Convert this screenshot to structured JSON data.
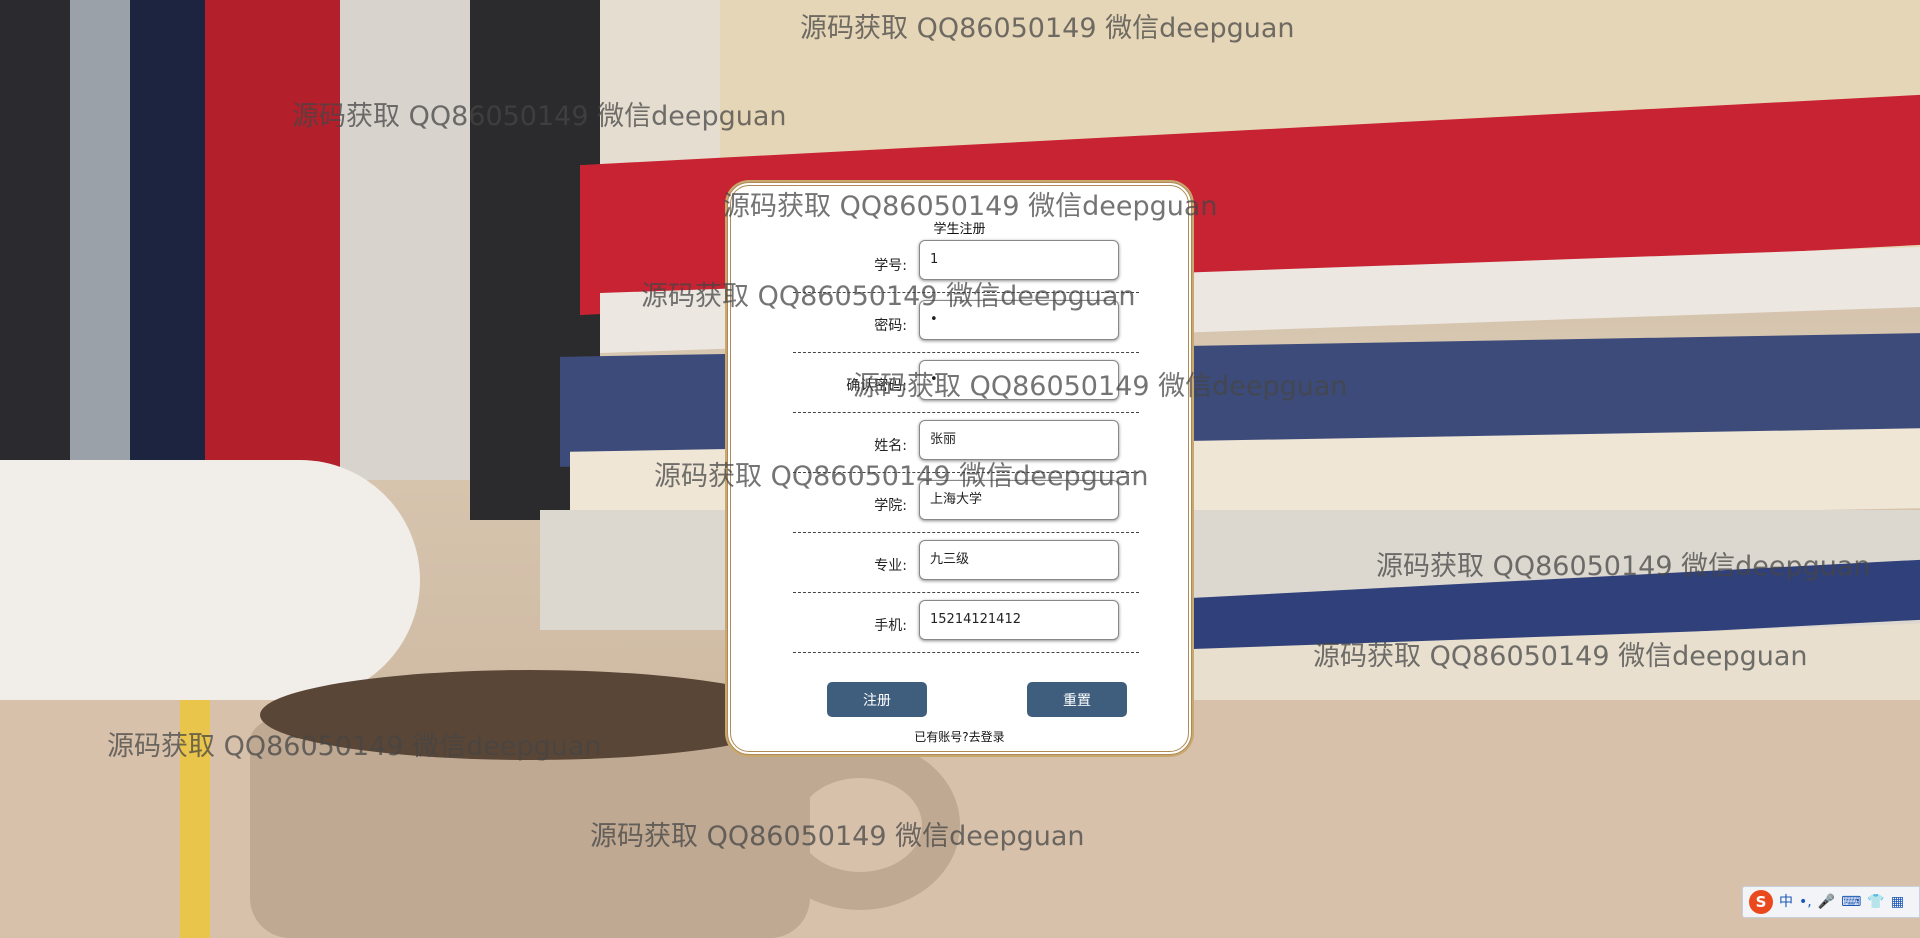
{
  "form": {
    "title": "学生注册",
    "fields": [
      {
        "label": "学号:",
        "value": "1"
      },
      {
        "label": "密码:",
        "value": "•"
      },
      {
        "label": "确认密码:",
        "value": "•"
      },
      {
        "label": "姓名:",
        "value": "张丽"
      },
      {
        "label": "学院:",
        "value": "上海大学"
      },
      {
        "label": "专业:",
        "value": "九三级"
      },
      {
        "label": "手机:",
        "value": "15214121412"
      }
    ],
    "register_label": "注册",
    "reset_label": "重置",
    "login_prompt": "已有账号?",
    "login_link": "去登录"
  },
  "watermark": {
    "text": "源码获取 QQ86050149 微信deepguan"
  },
  "ime": {
    "logo": "S",
    "mode": "中",
    "punct": "•,",
    "icons": [
      "microphone-icon",
      "keyboard-icon",
      "skin-icon",
      "toolbox-icon"
    ]
  },
  "colors": {
    "button": "#3f5d7d",
    "panel_border": "#b08a54",
    "watermark": "#464646"
  }
}
